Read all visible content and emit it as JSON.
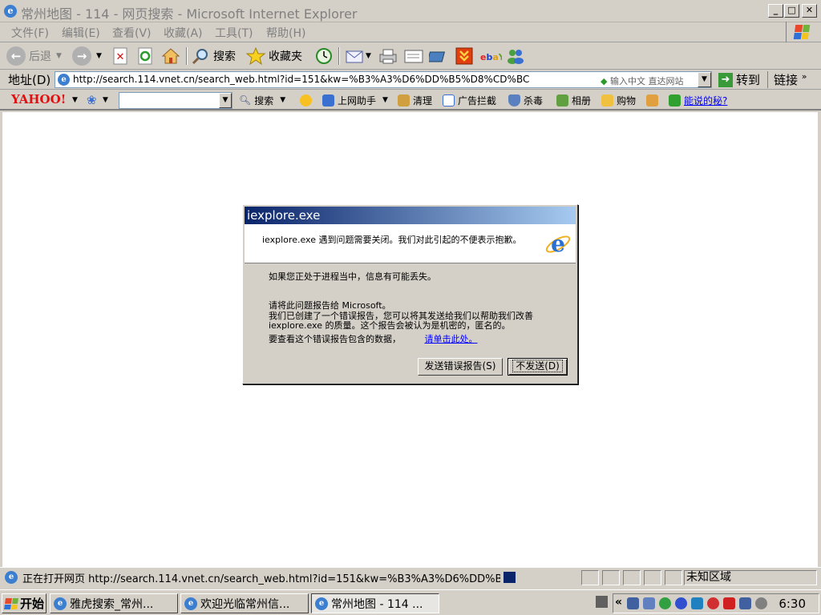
{
  "window": {
    "title": "常州地图 - 114 - 网页搜索 - Microsoft Internet Explorer",
    "min": "_",
    "max": "□",
    "close": "✕"
  },
  "menu": [
    "文件(F)",
    "编辑(E)",
    "查看(V)",
    "收藏(A)",
    "工具(T)",
    "帮助(H)"
  ],
  "toolbar": {
    "back": "后退",
    "search": "搜索",
    "favorites": "收藏夹"
  },
  "address": {
    "label": "地址(D)",
    "url": "http://search.114.vnet.cn/search_web.html?id=151&kw=%B3%A3%D6%DD%B5%D8%CD%BC",
    "hint": "输入中文 直达网站",
    "go": "转到",
    "links": "链接"
  },
  "yahoo_toolbar": {
    "logo": "YAHOO!",
    "search_value": "",
    "search_btn": "搜索",
    "items": [
      "上网助手",
      "清理",
      "广告拦截",
      "杀毒",
      "相册",
      "购物"
    ],
    "promo": "能说的秘?"
  },
  "dialog": {
    "title": "iexplore.exe",
    "header_text": "iexplore.exe 遇到问题需要关闭。我们对此引起的不便表示抱歉。",
    "line1": "如果您正处于进程当中，信息有可能丢失。",
    "line2": "请将此问题报告给 Microsoft。",
    "line3": "我们已创建了一个错误报告，您可以将其发送给我们以帮助我们改善 iexplore.exe 的质量。这个报告会被认为是机密的，匿名的。",
    "line4": "要查看这个错误报告包含的数据，",
    "link": "请单击此处。",
    "send_btn": "发送错误报告(S)",
    "dont_btn": "不发送(D)"
  },
  "status": {
    "text": "正在打开网页 http://search.114.vnet.cn/search_web.html?id=151&kw=%B3%A3%D6%DD%B5%D8%",
    "zone": "未知区域"
  },
  "taskbar": {
    "start": "开始",
    "tasks": [
      "雅虎搜索_常州...",
      "欢迎光临常州信...",
      "常州地图 - 114 ..."
    ],
    "clock": "6:30",
    "chevron": "«"
  },
  "colors": {
    "dialog_title_start": "#0a246a",
    "dialog_title_end": "#a6caf0",
    "yahoo_red": "#e01010",
    "link_blue": "#0000ff"
  }
}
